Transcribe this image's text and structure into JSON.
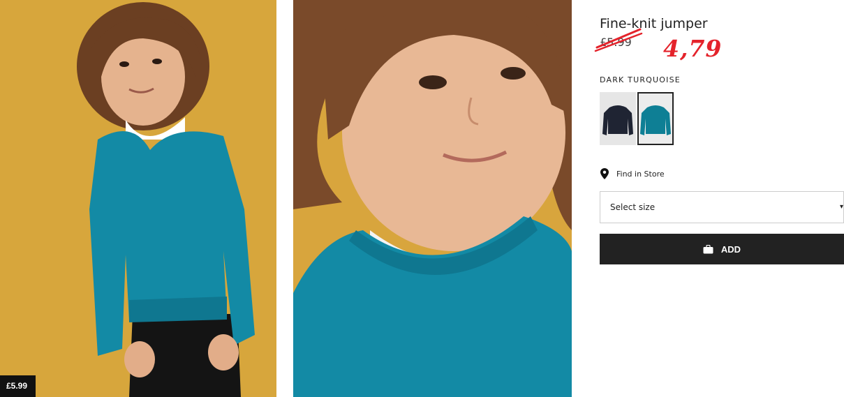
{
  "product": {
    "title": "Fine-knit jumper",
    "old_price": "£5.99",
    "new_price": "4,79",
    "price_tag": "£5.99",
    "color_label": "DARK TURQUOISE",
    "swatches": [
      {
        "name": "Dark blue",
        "color": "#1f2433"
      },
      {
        "name": "Dark turquoise",
        "color": "#0e7f95"
      }
    ]
  },
  "actions": {
    "find_in_store": "Find in Store",
    "size_select": "Select size",
    "add_label": "ADD"
  },
  "colors": {
    "background_mustard": "#d7a63c",
    "sweater_teal": "#138aa5",
    "accent_red": "#e4232b",
    "button_dark": "#222222"
  },
  "icons": {
    "location": "location-pin-icon",
    "bag": "shopping-bag-icon",
    "chevron": "chevron-down-icon"
  }
}
